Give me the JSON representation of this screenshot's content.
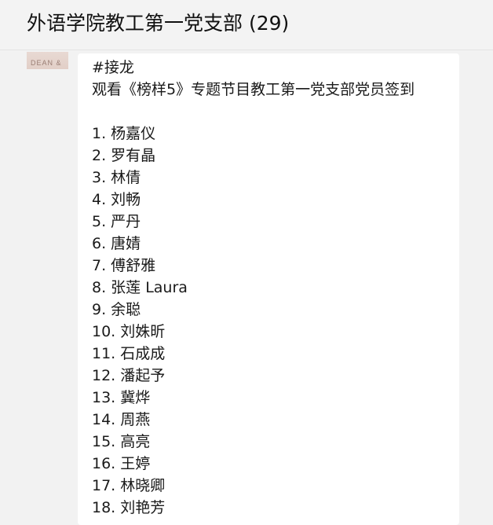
{
  "window": {
    "title": "外语学院教工第一党支部 (29)"
  },
  "sender": {
    "avatar_text": "DEAN &"
  },
  "message": {
    "tag": "#接龙",
    "header": "观看《榜样5》专题节目教工第一党支部党员签到",
    "items": [
      "1. 杨嘉仪",
      "2. 罗有晶",
      "3. 林倩",
      "4. 刘畅",
      "5. 严丹",
      "6. 唐婧",
      "7. 傅舒雅",
      "8. 张莲 Laura",
      "9. 余聪",
      "10. 刘姝昕",
      "11. 石成成",
      "12. 潘起予",
      "13. 冀烨",
      "14. 周燕",
      "15. 高亮",
      "16. 王婷",
      "17. 林晓卿",
      "18. 刘艳芳"
    ]
  }
}
